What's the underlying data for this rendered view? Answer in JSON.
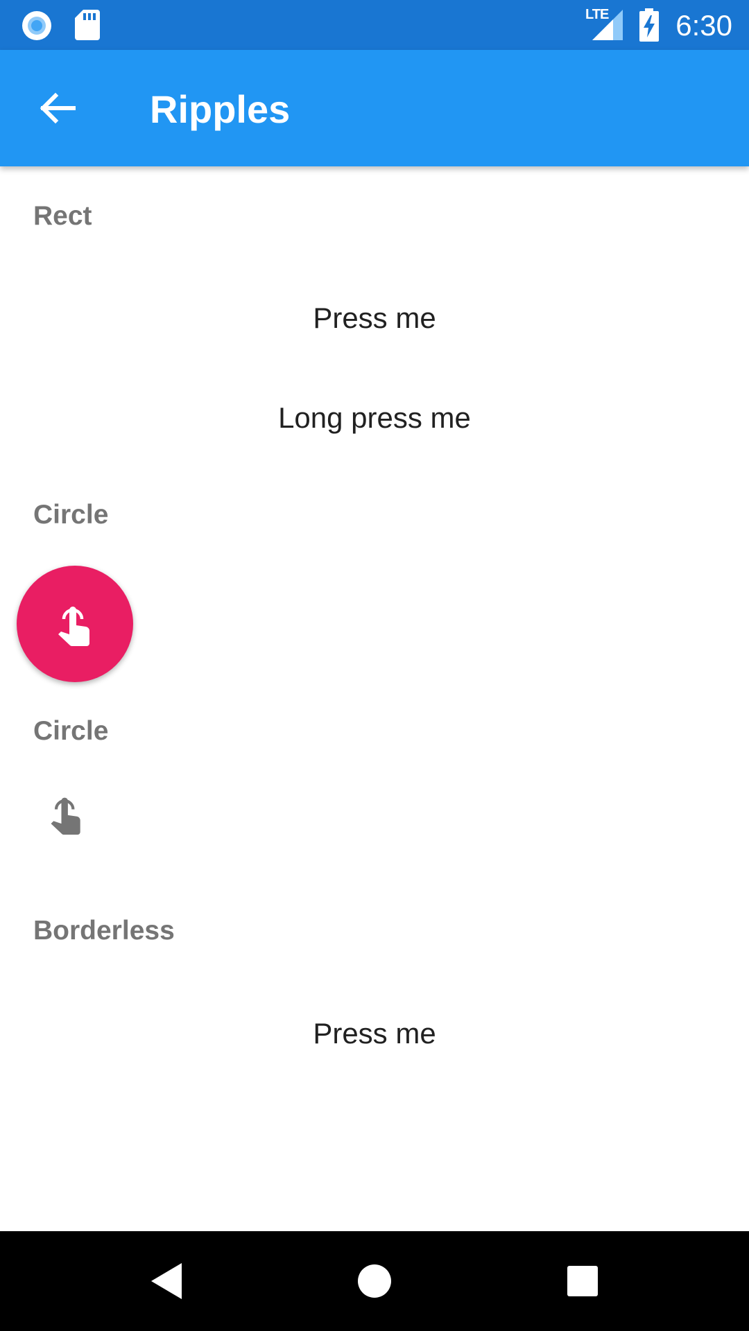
{
  "status_bar": {
    "time": "6:30",
    "network_label": "LTE",
    "icons": [
      "radio-icon",
      "sd-card-icon",
      "lte-signal-icon",
      "battery-charging-icon"
    ],
    "color": "#1976D2"
  },
  "app_bar": {
    "title": "Ripples",
    "back_icon": "arrow-back-icon",
    "color": "#2196F3"
  },
  "sections": {
    "rect": {
      "label": "Rect",
      "press_label": "Press me",
      "long_press_label": "Long press me"
    },
    "circle_fab": {
      "label": "Circle",
      "icon": "touch-icon",
      "color": "#E91E63"
    },
    "circle_plain": {
      "label": "Circle",
      "icon": "touch-icon"
    },
    "borderless": {
      "label": "Borderless",
      "press_label": "Press me"
    }
  },
  "nav_bar": {
    "icons": [
      "nav-back-icon",
      "nav-home-icon",
      "nav-recents-icon"
    ]
  }
}
